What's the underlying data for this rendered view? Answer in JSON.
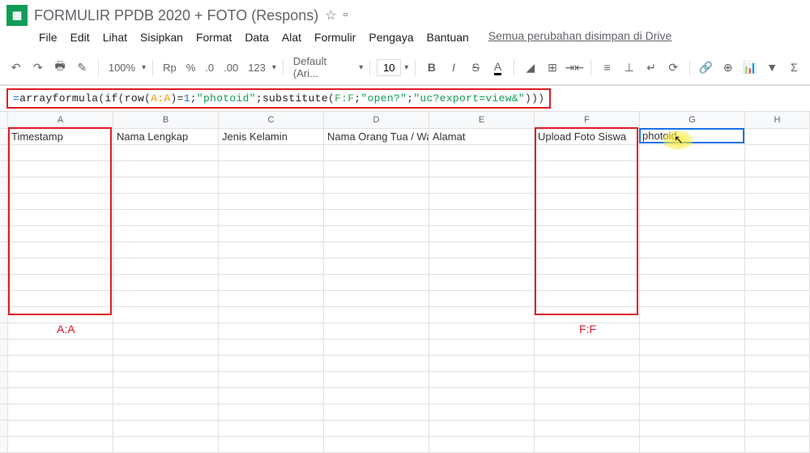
{
  "header": {
    "doc_title": "FORMULIR PPDB 2020 + FOTO (Respons)",
    "star": "☆",
    "folder": "▫"
  },
  "menu": {
    "items": [
      "File",
      "Edit",
      "Lihat",
      "Sisipkan",
      "Format",
      "Data",
      "Alat",
      "Formulir",
      "Pengaya",
      "Bantuan"
    ],
    "save_status": "Semua perubahan disimpan di Drive"
  },
  "toolbar": {
    "zoom": "100%",
    "currency": "Rp",
    "percent": "%",
    "dec_minus": ".0",
    "dec_plus": ".00",
    "more_fmt": "123",
    "font": "Default (Ari...",
    "font_size": "10"
  },
  "formula": {
    "parts": {
      "p0": "=",
      "p1": "arrayformula",
      "p2": "(",
      "p3": "if",
      "p4": "(",
      "p5": "row",
      "p6": "(",
      "p7": "A:A",
      "p8": ")=",
      "p9": "1",
      "p10": ";",
      "p11": "\"photoid\"",
      "p12": ";",
      "p13": "substitute",
      "p14": "(",
      "p15": "F:F",
      "p16": ";",
      "p17": "\"open?\"",
      "p18": ";",
      "p19": "\"uc?export=view&\"",
      "p20": ")))"
    }
  },
  "columns": {
    "labels": [
      "A",
      "B",
      "C",
      "D",
      "E",
      "F",
      "G",
      "H"
    ],
    "headers": [
      "Timestamp",
      "Nama Lengkap",
      "Jenis Kelamin",
      "Nama Orang Tua / Wali",
      "Alamat",
      "Upload Foto Siswa",
      "",
      ""
    ]
  },
  "active_cell": {
    "value": "photoid"
  },
  "annotations": {
    "a": "A:A",
    "f": "F:F"
  }
}
